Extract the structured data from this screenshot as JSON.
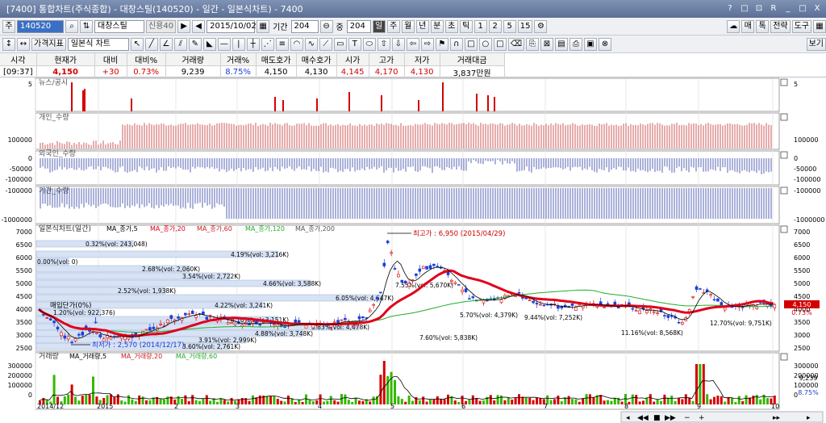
{
  "window": {
    "title": "[7400] 통합차트(주식종합) - 대창스틸(140520) - 일간 - 일본식차트) - 7400",
    "buttons": [
      "?",
      "□",
      "⊡",
      "R",
      "_",
      "□",
      "X"
    ]
  },
  "toolbar1": {
    "market": "주",
    "code": "140520",
    "name": "대창스틸",
    "badge": "신용40",
    "date": "2015/10/02",
    "period_label": "기간",
    "period_value": "204",
    "center_label": "중",
    "center_value": "204",
    "period_buttons": [
      "일",
      "주",
      "월",
      "년",
      "분",
      "초",
      "틱",
      "1",
      "2",
      "5",
      "15"
    ],
    "right_buttons": [
      "매",
      "톡",
      "전략",
      "도구"
    ]
  },
  "toolbar2": {
    "indicator_label": "가격지표",
    "chart_type": "일본식 차트",
    "right_button": "보기"
  },
  "quote": {
    "headers": [
      "시각",
      "현재가",
      "대비",
      "대비%",
      "거래량",
      "거래%",
      "매도호가",
      "매수호가",
      "시가",
      "고가",
      "저가",
      "거래대금"
    ],
    "values": [
      "[09:37]",
      "4,150",
      "+30",
      "0.73%",
      "9,239",
      "8.75%",
      "4,150",
      "4,130",
      "4,145",
      "4,170",
      "4,130",
      "3,837만원"
    ]
  },
  "panels": {
    "news": "뉴스/공시",
    "individual": "개인_수량",
    "foreign": "외국인_수량",
    "institution": "기관_수량",
    "price": "일본식차트(일간)",
    "volume": "거래량"
  },
  "legend_price": [
    "MA_종가,5",
    "MA_종가,20",
    "MA_종가,60",
    "MA_종가,120",
    "MA_종가,200"
  ],
  "legend_volume": [
    "MA_거래량,5",
    "MA_거래량,20",
    "MA_거래량,60"
  ],
  "axis": {
    "price_ticks": [
      "7000",
      "6500",
      "6000",
      "5500",
      "5000",
      "4500",
      "4000",
      "3500",
      "3000",
      "2500"
    ],
    "volume_ticks": [
      "300000",
      "200000",
      "100000",
      "0"
    ],
    "news_tick": "5",
    "indiv_tick": "100000",
    "foreign_ticks": [
      "0",
      "-50000",
      "-100000"
    ],
    "inst_ticks": [
      "-100000",
      "-1000000"
    ],
    "x_ticks": [
      "2014/12",
      "2015",
      "2",
      "3",
      "4",
      "5",
      "6",
      "7",
      "8",
      "9",
      "10"
    ],
    "current_price": "4,150",
    "current_change": "0.73%",
    "current_volume": "9,239",
    "current_volume_pct": "8.75%"
  },
  "annotations": {
    "high": "최고가 : 6,950 (2015/04/29)",
    "low": "최저가 : 2,570 (2014/12/17)",
    "buy": "매입단가(0%)",
    "profile": [
      "0.32%(vol: 243,048)",
      "4.19%(vol: 3,216K)",
      "0.00%(vol: 0)",
      "2.68%(vol: 2,060K)",
      "3.54%(vol: 2,722K)",
      "4.66%(vol: 3,588K)",
      "2.52%(vol: 1,938K)",
      "6.05%(vol: 4,647K)",
      "4.22%(vol: 3,241K)",
      "1.20%(vol: 922,376)",
      "4.10%(vol: 3,151K)",
      "5.83%(vol: 4,478K)",
      "4.88%(vol: 3,748K)",
      "3.91%(vol: 2,999K)",
      "3.60%(vol: 2,761K)",
      "7.60%(vol: 5,838K)",
      "9.44%(vol: 7,252K)",
      "11.16%(vol: 8,568K)",
      "12.70%(vol: 9,751K)",
      "5.70%(vol: 4,379K)",
      "7.55%(vol: 5,670K)"
    ]
  },
  "colors": {
    "up": "#d40000",
    "down": "#1c3fd6",
    "ma20": "#e0001a",
    "ma60": "#1fae2d",
    "ma5": "#000000",
    "profile": "#c8d6ee"
  }
}
